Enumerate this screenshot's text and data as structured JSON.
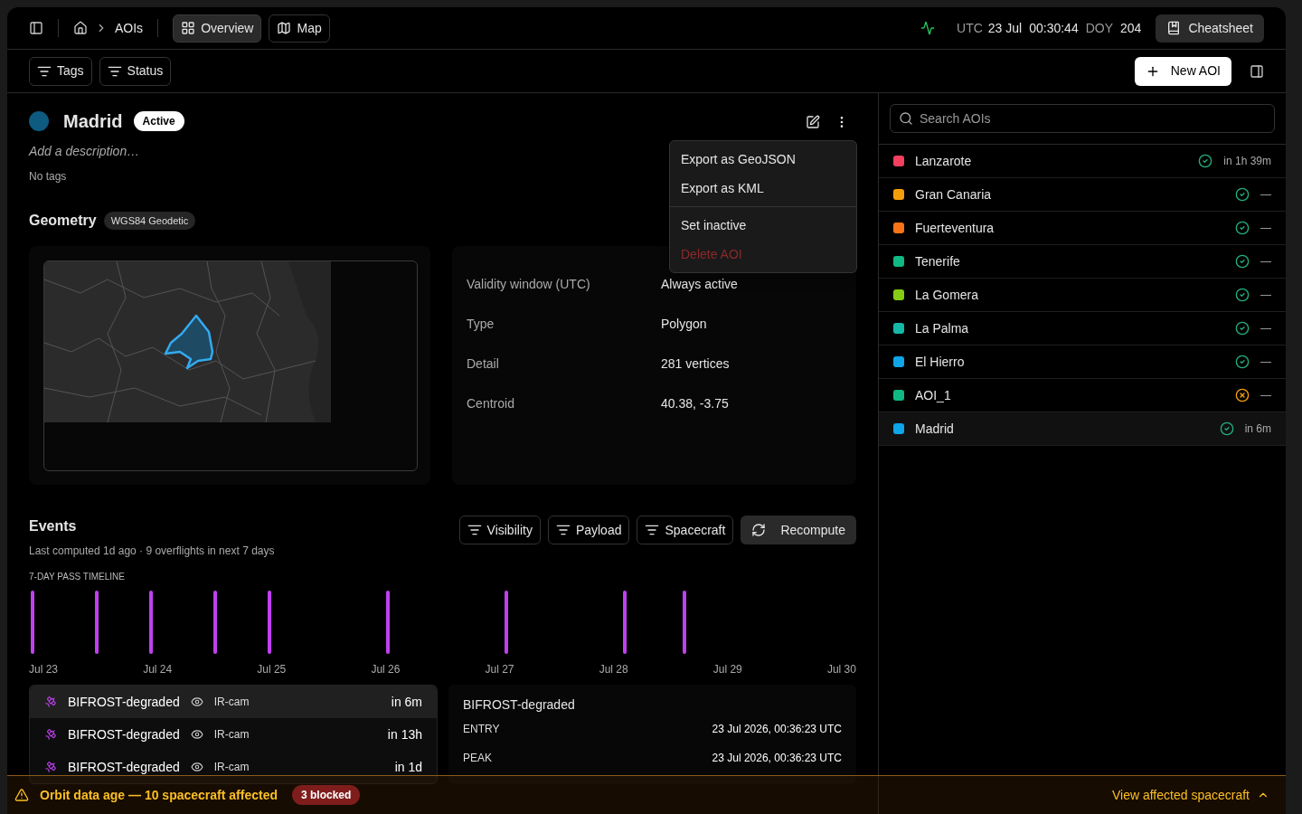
{
  "topbar": {
    "breadcrumb": [
      "AOIs"
    ],
    "tabs": [
      {
        "label": "Overview",
        "selected": true
      },
      {
        "label": "Map",
        "selected": false
      }
    ],
    "clock": {
      "zone": "UTC",
      "date": "23 Jul",
      "time": "00:30:44",
      "doy_label": "DOY",
      "doy": "204"
    },
    "cheatsheet": "Cheatsheet"
  },
  "toolbar": {
    "filters": [
      "Tags",
      "Status"
    ],
    "new_button": "New AOI"
  },
  "aoi": {
    "name": "Madrid",
    "color": "#0e5a80",
    "status": "Active",
    "description_placeholder": "Add a description…",
    "tags": "No tags"
  },
  "menu": {
    "groups": [
      [
        {
          "label": "Export as GeoJSON",
          "kind": "normal"
        },
        {
          "label": "Export as KML",
          "kind": "normal"
        }
      ],
      [
        {
          "label": "Set inactive",
          "kind": "normal"
        },
        {
          "label": "Delete AOI",
          "kind": "danger"
        }
      ]
    ]
  },
  "geometry": {
    "title": "Geometry",
    "crs": "WGS84 Geodetic",
    "details": [
      {
        "label": "Validity window (UTC)",
        "value": "Always active"
      },
      {
        "label": "Type",
        "value": "Polygon"
      },
      {
        "label": "Detail",
        "value": "281 vertices"
      },
      {
        "label": "Centroid",
        "value": "40.38, -3.75"
      }
    ]
  },
  "events": {
    "title": "Events",
    "subtitle": "Last computed 1d ago · 9 overflights in next 7 days",
    "filters": [
      "Visibility",
      "Payload",
      "Spacecraft"
    ],
    "recompute": "Recompute",
    "timeline_title": "7-DAY PASS TIMELINE",
    "timeline_labels": [
      "Jul 23",
      "Jul 24",
      "Jul 25",
      "Jul 26",
      "Jul 27",
      "Jul 28",
      "Jul 29",
      "Jul 30"
    ],
    "rows": [
      {
        "name": "BIFROST-degraded",
        "payload": "IR-cam",
        "time": "in 6m",
        "selected": true
      },
      {
        "name": "BIFROST-degraded",
        "payload": "IR-cam",
        "time": "in 13h",
        "selected": false
      },
      {
        "name": "BIFROST-degraded",
        "payload": "IR-cam",
        "time": "in 1d",
        "selected": false
      }
    ],
    "detail": {
      "title": "BIFROST-degraded",
      "fields": [
        {
          "label": "ENTRY",
          "value": "23 Jul 2026, 00:36:23 UTC"
        },
        {
          "label": "PEAK",
          "value": "23 Jul 2026, 00:36:23 UTC"
        }
      ]
    }
  },
  "sidebar": {
    "search_placeholder": "Search AOIs",
    "items": [
      {
        "name": "Lanzarote",
        "color": "#f43f5e",
        "kind": "ok",
        "next": "in 1h 39m",
        "selected": false
      },
      {
        "name": "Gran Canaria",
        "color": "#f59e0b",
        "kind": "ok",
        "next": "—",
        "selected": false
      },
      {
        "name": "Fuerteventura",
        "color": "#f97316",
        "kind": "ok",
        "next": "—",
        "selected": false
      },
      {
        "name": "Tenerife",
        "color": "#10b981",
        "kind": "ok",
        "next": "—",
        "selected": false
      },
      {
        "name": "La Gomera",
        "color": "#84cc16",
        "kind": "ok",
        "next": "—",
        "selected": false
      },
      {
        "name": "La Palma",
        "color": "#14b8a6",
        "kind": "ok",
        "next": "—",
        "selected": false
      },
      {
        "name": "El Hierro",
        "color": "#0ea5e9",
        "kind": "ok",
        "next": "—",
        "selected": false
      },
      {
        "name": "AOI_1",
        "color": "#10b981",
        "kind": "error",
        "next": "—",
        "selected": false
      },
      {
        "name": "Madrid",
        "color": "#0ea5e9",
        "kind": "ok",
        "next": "in 6m",
        "selected": true
      }
    ]
  },
  "banner": {
    "message": "Orbit data age — 10 spacecraft affected",
    "badge": "3 blocked",
    "link": "View affected spacecraft"
  }
}
